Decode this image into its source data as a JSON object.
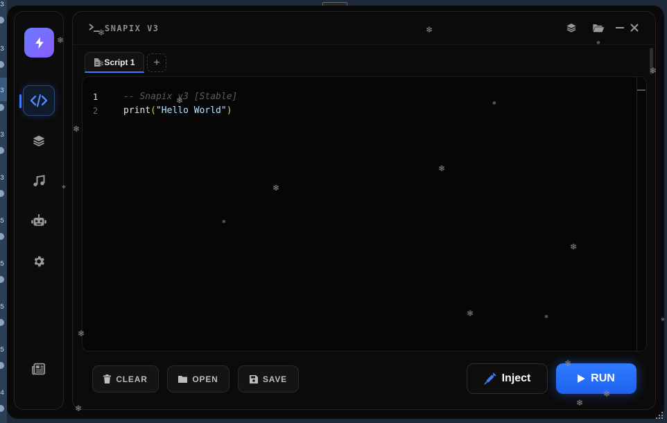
{
  "window": {
    "title": "SNAPIX V3"
  },
  "edge": {
    "numbers": [
      "3",
      "3",
      "3",
      "3",
      "3",
      "5",
      "5",
      "5",
      "5",
      "4"
    ]
  },
  "sidebar": {
    "items": [
      {
        "icon": "code-icon",
        "active": true
      },
      {
        "icon": "layers-icon",
        "active": false
      },
      {
        "icon": "music-icon",
        "active": false
      },
      {
        "icon": "robot-icon",
        "active": false
      },
      {
        "icon": "gear-icon",
        "active": false
      },
      {
        "icon": "newspaper-icon",
        "active": false
      }
    ]
  },
  "tabs": [
    {
      "label": "Script 1",
      "icon": "file-icon"
    }
  ],
  "tab_add_label": "+",
  "editor": {
    "lines": [
      "1",
      "2"
    ],
    "code": {
      "line1_comment": "-- Snapix v3 [Stable]",
      "line2_fn": "print",
      "line2_open": "(",
      "line2_string": "\"Hello World\"",
      "line2_close": ")"
    }
  },
  "buttons": {
    "clear": "CLEAR",
    "open": "OPEN",
    "save": "SAVE",
    "inject": "Inject",
    "run": "RUN"
  },
  "colors": {
    "accent": "#2f7bff",
    "logo_gradient_start": "#6a7bff",
    "logo_gradient_end": "#8a5cff",
    "background": "#0a0a0a"
  }
}
